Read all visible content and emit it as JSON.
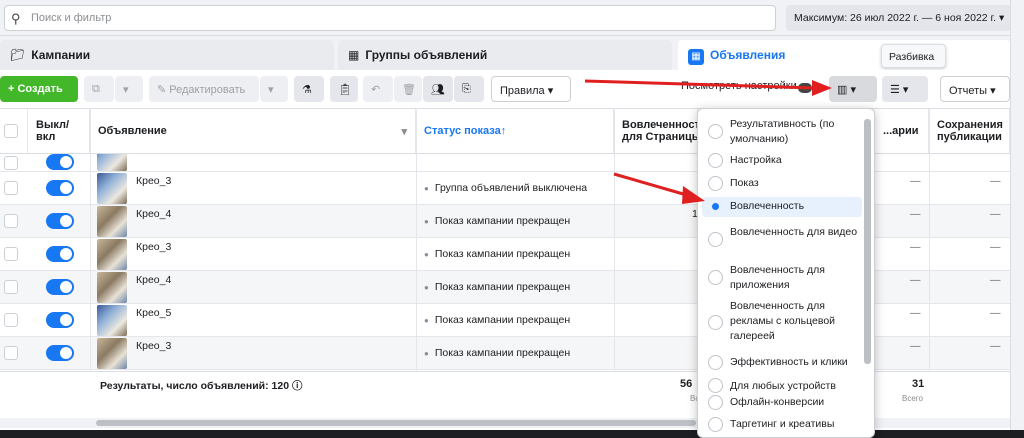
{
  "search": {
    "placeholder": "Поиск и фильтр"
  },
  "date_range": "Максимум: 26 июл 2022 г. — 6 ноя 2022 г.",
  "tabs": [
    {
      "label": "Кампании",
      "icon": "folder-icon"
    },
    {
      "label": "Группы объявлений",
      "icon": "grid-icon"
    },
    {
      "label": "Объявления",
      "icon": "ad-icon"
    }
  ],
  "tooltip": "Разбивка",
  "toolbar": {
    "create": "Создать",
    "edit": "Редактировать",
    "rules": "Правила",
    "view_settings": "Посмотреть настройки",
    "reports": "Отчеты"
  },
  "columns": {
    "toggle": "Выкл/вкл",
    "ad": "Объявление",
    "status": "Статус показа",
    "engagement": "Вовлеченность для Страницы",
    "comments": "...арии",
    "saves": "Сохранения публикации"
  },
  "rows": [
    {
      "name": "Крео_3",
      "status": "Группа объявлений выключена",
      "engagement": "",
      "comments": "—",
      "saves": "—"
    },
    {
      "name": "Крео_4",
      "status": "Показ кампании прекращен",
      "engagement": "1",
      "comments": "—",
      "saves": "—"
    },
    {
      "name": "Крео_3",
      "status": "Показ кампании прекращен",
      "engagement": "",
      "comments": "—",
      "saves": "—"
    },
    {
      "name": "Крео_4",
      "status": "Показ кампании прекращен",
      "engagement": "",
      "comments": "—",
      "saves": "—"
    },
    {
      "name": "Крео_5",
      "status": "Показ кампании прекращен",
      "engagement": "",
      "comments": "—",
      "saves": "—"
    },
    {
      "name": "Крео_3",
      "status": "Показ кампании прекращен",
      "engagement": "",
      "comments": "—",
      "saves": "—"
    }
  ],
  "footer": {
    "results": "Результаты, число объявлений: 120",
    "engagement_total": "56",
    "comments_total": "31",
    "total_label": "Всего"
  },
  "dropdown": {
    "options": [
      {
        "label": "Результативность (по умолчанию)",
        "selected": false
      },
      {
        "label": "Настройка",
        "selected": false
      },
      {
        "label": "Показ",
        "selected": false
      },
      {
        "label": "Вовлеченность",
        "selected": true
      },
      {
        "label": "Вовлеченность для видео",
        "selected": false
      },
      {
        "label": "Вовлеченность для приложения",
        "selected": false
      },
      {
        "label": "Вовлеченность для рекламы с кольцевой галереей",
        "selected": false
      },
      {
        "label": "Эффективность и клики",
        "selected": false
      },
      {
        "label": "Для любых устройств",
        "selected": false
      },
      {
        "label": "Офлайн-конверсии",
        "selected": false
      },
      {
        "label": "Таргетинг и креативы",
        "selected": false
      }
    ]
  },
  "colors": {
    "accent": "#1877f2",
    "create": "#42b72a",
    "annotation_arrow": "#e02020"
  }
}
